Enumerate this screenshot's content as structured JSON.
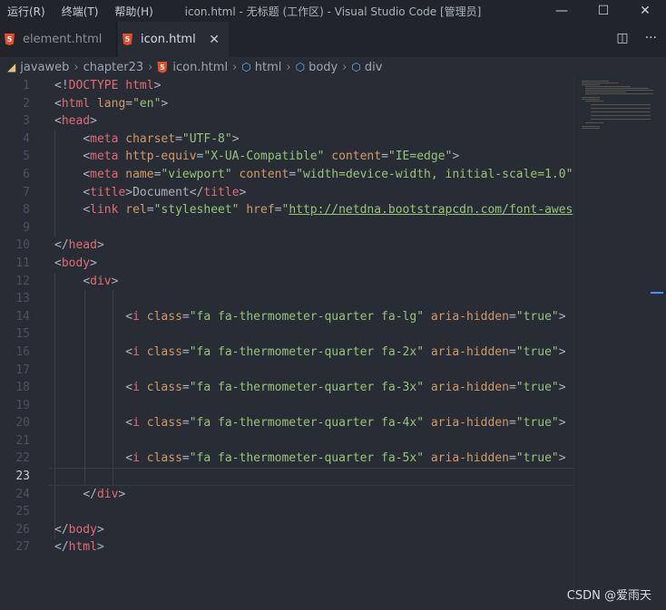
{
  "menu": [
    "运行(R)",
    "终端(T)",
    "帮助(H)"
  ],
  "window_title": "icon.html - 无标题 (工作区) - Visual Studio Code [管理员]",
  "window_controls": {
    "minimize": "—",
    "maximize": "☐",
    "close": "✕"
  },
  "tabs": [
    {
      "label": "element.html",
      "active": false
    },
    {
      "label": "icon.html",
      "active": true,
      "close": "✕"
    }
  ],
  "tab_actions": {
    "split": "◫",
    "more": "···"
  },
  "breadcrumbs": [
    "javaweb",
    "chapter23",
    "icon.html",
    "html",
    "body",
    "div"
  ],
  "line_numbers": [
    "1",
    "2",
    "3",
    "4",
    "5",
    "6",
    "7",
    "8",
    "9",
    "10",
    "11",
    "12",
    "13",
    "14",
    "15",
    "16",
    "17",
    "18",
    "19",
    "20",
    "21",
    "22",
    "23",
    "24",
    "25",
    "26",
    "27"
  ],
  "current_line": 23,
  "code": {
    "l1": {
      "lt": "<!",
      "tag": "DOCTYPE",
      "sp": " ",
      "word": "html",
      "gt": ">"
    },
    "l2": {
      "lt": "<",
      "tag": "html",
      "attr": " lang",
      "eq": "=",
      "val": "\"en\"",
      "gt": ">"
    },
    "l3": {
      "lt": "<",
      "tag": "head",
      "gt": ">"
    },
    "l4": {
      "lt": "<",
      "tag": "meta",
      "attr": " charset",
      "eq": "=",
      "val": "\"UTF-8\"",
      "gt": ">"
    },
    "l5": {
      "lt": "<",
      "tag": "meta",
      "attr1": " http-equiv",
      "eq1": "=",
      "val1": "\"X-UA-Compatible\"",
      "attr2": " content",
      "eq2": "=",
      "val2": "\"IE=edge\"",
      "gt": ">"
    },
    "l6": {
      "lt": "<",
      "tag": "meta",
      "attr1": " name",
      "eq1": "=",
      "val1": "\"viewport\"",
      "attr2": " content",
      "eq2": "=",
      "val2": "\"width=device-width, initial-scale=1.0\""
    },
    "l7": {
      "lt": "<",
      "tag": "title",
      "gt": ">",
      "text": "Document",
      "close_lt": "</",
      "close_tag": "title",
      "close_gt": ">"
    },
    "l8": {
      "lt": "<",
      "tag": "link",
      "attr1": " rel",
      "eq1": "=",
      "val1": "\"stylesheet\"",
      "attr2": " href",
      "eq2": "=",
      "q": "\"",
      "url": "http://netdna.bootstrapcdn.com/font-awes"
    },
    "l10": {
      "lt": "</",
      "tag": "head",
      "gt": ">"
    },
    "l11": {
      "lt": "<",
      "tag": "body",
      "gt": ">"
    },
    "l12": {
      "lt": "<",
      "tag": "div",
      "gt": ">"
    },
    "icon_lines": [
      {
        "lt": "<",
        "tag": "i",
        "attr1": " class",
        "eq1": "=",
        "val1": "\"fa fa-thermometer-quarter fa-lg\"",
        "attr2": " aria-hidden",
        "eq2": "=",
        "val2": "\"true\"",
        "gt": ">"
      },
      {
        "lt": "<",
        "tag": "i",
        "attr1": " class",
        "eq1": "=",
        "val1": "\"fa fa-thermometer-quarter fa-2x\"",
        "attr2": " aria-hidden",
        "eq2": "=",
        "val2": "\"true\"",
        "gt": ">"
      },
      {
        "lt": "<",
        "tag": "i",
        "attr1": " class",
        "eq1": "=",
        "val1": "\"fa fa-thermometer-quarter fa-3x\"",
        "attr2": " aria-hidden",
        "eq2": "=",
        "val2": "\"true\"",
        "gt": ">"
      },
      {
        "lt": "<",
        "tag": "i",
        "attr1": " class",
        "eq1": "=",
        "val1": "\"fa fa-thermometer-quarter fa-4x\"",
        "attr2": " aria-hidden",
        "eq2": "=",
        "val2": "\"true\"",
        "gt": ">"
      },
      {
        "lt": "<",
        "tag": "i",
        "attr1": " class",
        "eq1": "=",
        "val1": "\"fa fa-thermometer-quarter fa-5x\"",
        "attr2": " aria-hidden",
        "eq2": "=",
        "val2": "\"true\"",
        "gt": ">"
      }
    ],
    "l24": {
      "lt": "</",
      "tag": "div",
      "gt": ">"
    },
    "l26": {
      "lt": "</",
      "tag": "body",
      "gt": ">"
    },
    "l27": {
      "lt": "</",
      "tag": "html",
      "gt": ">"
    }
  },
  "watermark": "CSDN @爱雨天",
  "colors": {
    "tag": "#e06c75",
    "attr": "#d19a66",
    "string": "#98c379",
    "plain": "#abb2bf",
    "bg": "#282c34",
    "accent": "#528bff"
  }
}
